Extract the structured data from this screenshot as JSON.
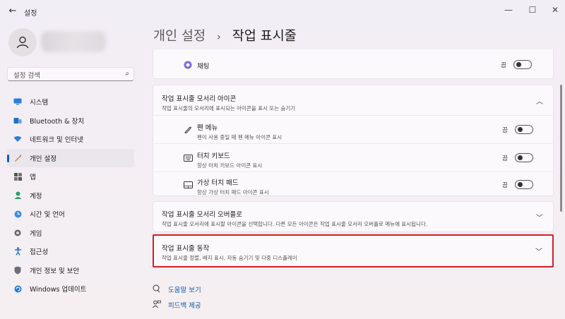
{
  "window": {
    "title": "설정",
    "controls": {
      "minimize": "—",
      "maximize": "☐",
      "close": "✕"
    }
  },
  "sidebar": {
    "search_placeholder": "설정 검색",
    "items": [
      {
        "label": "시스템",
        "icon": "system-icon"
      },
      {
        "label": "Bluetooth & 장치",
        "icon": "bluetooth-icon"
      },
      {
        "label": "네트워크 및 인터넷",
        "icon": "network-icon"
      },
      {
        "label": "개인 설정",
        "icon": "personalization-icon",
        "active": true
      },
      {
        "label": "앱",
        "icon": "apps-icon"
      },
      {
        "label": "계정",
        "icon": "accounts-icon"
      },
      {
        "label": "시간 및 언어",
        "icon": "time-language-icon"
      },
      {
        "label": "게임",
        "icon": "gaming-icon"
      },
      {
        "label": "접근성",
        "icon": "accessibility-icon"
      },
      {
        "label": "개인 정보 및 보안",
        "icon": "privacy-icon"
      },
      {
        "label": "Windows 업데이트",
        "icon": "windows-update-icon"
      }
    ]
  },
  "breadcrumb": {
    "parent": "개인 설정",
    "separator": "›",
    "current": "작업 표시줄"
  },
  "content": {
    "chat": {
      "label": "채팅",
      "toggle_label": "끔"
    },
    "corner_icons": {
      "title": "작업 표시줄 모서리 아이콘",
      "subtitle": "작업 표시줄의 모서리에 표시되는 아이콘을 표시 또는 숨기기",
      "items": [
        {
          "title": "펜 메뉴",
          "subtitle": "펜이 사용 중일 때 펜 메뉴 아이콘 표시",
          "toggle_label": "끔"
        },
        {
          "title": "터치 키보드",
          "subtitle": "항상 터치 키보드 아이콘 표시",
          "toggle_label": "끔"
        },
        {
          "title": "가상 터치 패드",
          "subtitle": "항상 가상 터치 패드 아이콘 표시",
          "toggle_label": "끔"
        }
      ]
    },
    "overflow": {
      "title": "작업 표시줄 모서리 오버플로",
      "subtitle": "작업 표시줄 모서리에 표시할 아이콘을 선택합니다. 다른 모든 아이콘은 작업 표시줄 모서리 오버플로 메뉴에 표시됩니다."
    },
    "behaviors": {
      "title": "작업 표시줄 동작",
      "subtitle": "작업 표시줄 정렬, 배지 표시, 자동 숨기기 및 다중 디스플레이"
    }
  },
  "links": {
    "help": "도움말 보기",
    "feedback": "피드백 제공"
  },
  "colors": {
    "accent": "#0060c0",
    "highlight_border": "#d11e2a"
  }
}
